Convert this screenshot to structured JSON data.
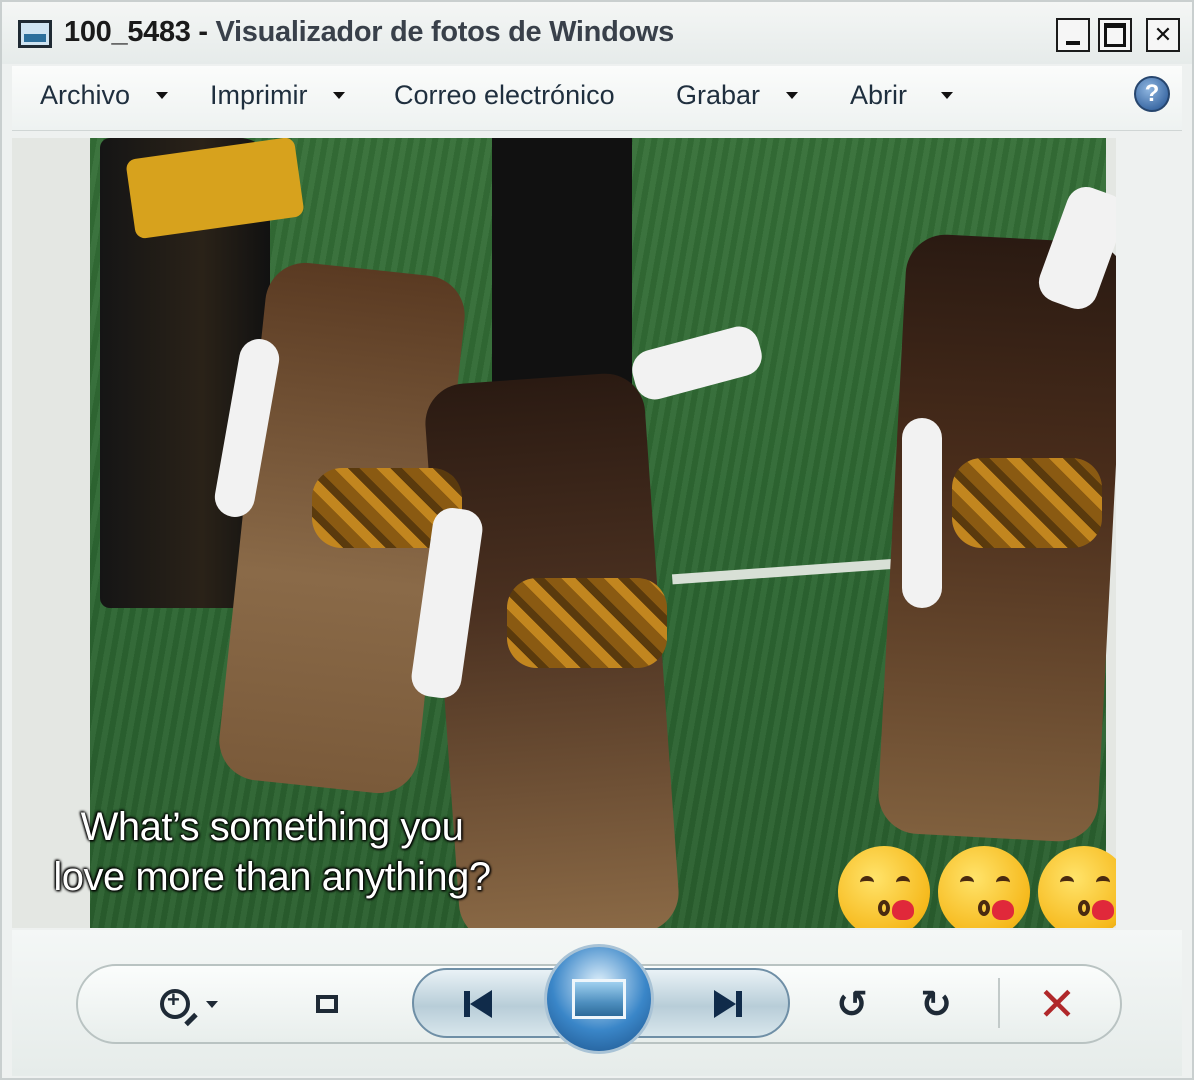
{
  "window": {
    "title_file": "100_5483",
    "title_separator": " - ",
    "title_app": "Visualizador de fotos de Windows"
  },
  "menu": {
    "items": [
      {
        "label": "Archivo",
        "has_dropdown": true
      },
      {
        "label": "Imprimir",
        "has_dropdown": true
      },
      {
        "label": "Correo electrónico",
        "has_dropdown": false
      },
      {
        "label": "Grabar",
        "has_dropdown": true
      },
      {
        "label": "Abrir",
        "has_dropdown": true
      }
    ],
    "help_icon": "help-icon",
    "help_symbol": "?"
  },
  "photo": {
    "caption_line1": "What’s something you",
    "caption_line2": "love more than anything?",
    "emojis": [
      "face-blowing-kiss",
      "face-blowing-kiss",
      "face-blowing-kiss"
    ]
  },
  "controls": {
    "zoom_icon": "zoom-icon",
    "fit_icon": "actual-size-icon",
    "prev_icon": "previous-icon",
    "slideshow_icon": "slideshow-icon",
    "next_icon": "next-icon",
    "rotate_left_symbol": "↺",
    "rotate_right_symbol": "↻",
    "delete_symbol": "✕"
  },
  "colors": {
    "delete": "#b0282a",
    "slideshow_accent": "#3a86c8"
  }
}
